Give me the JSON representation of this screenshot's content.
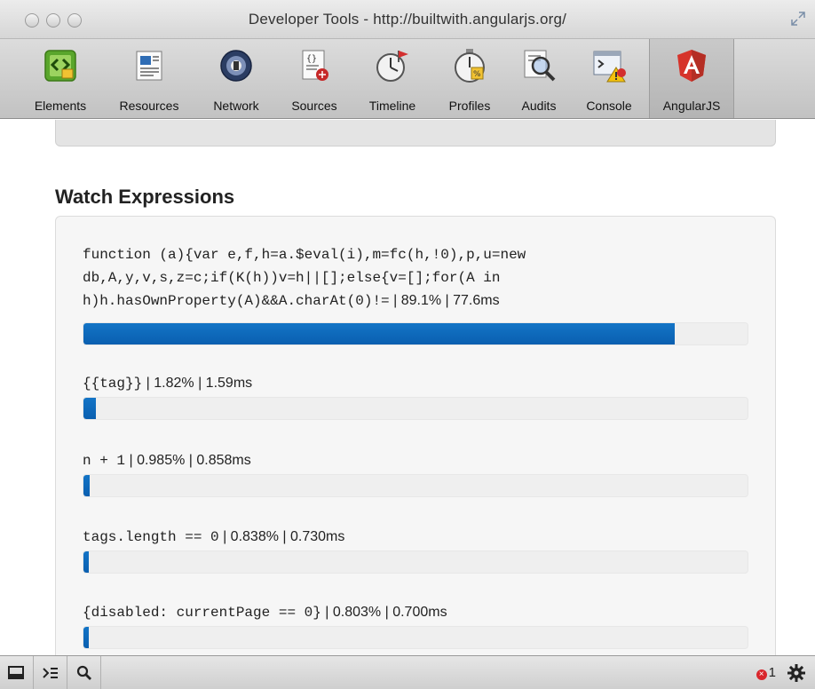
{
  "window": {
    "title": "Developer Tools - http://builtwith.angularjs.org/"
  },
  "toolbar": {
    "tabs": [
      {
        "label": "Elements",
        "icon": "elements-icon"
      },
      {
        "label": "Resources",
        "icon": "resources-icon"
      },
      {
        "label": "Network",
        "icon": "network-icon"
      },
      {
        "label": "Sources",
        "icon": "sources-icon"
      },
      {
        "label": "Timeline",
        "icon": "timeline-icon"
      },
      {
        "label": "Profiles",
        "icon": "profiles-icon"
      },
      {
        "label": "Audits",
        "icon": "audits-icon"
      },
      {
        "label": "Console",
        "icon": "console-icon"
      },
      {
        "label": "AngularJS",
        "icon": "angularjs-icon",
        "active": true
      }
    ]
  },
  "watch": {
    "title": "Watch Expressions",
    "items": [
      {
        "expression": "function (a){var e,f,h=a.$eval(i),m=fc(h,!0),p,u=new db,A,y,v,s,z=c;if(K(h))v=h||[];else{v=[];for(A in h)h.hasOwnProperty(A)&&A.charAt(0)!=",
        "stats": " | 89.1% | 77.6ms",
        "percent": 89.1
      },
      {
        "expression": "{{tag}}",
        "stats": " | 1.82% | 1.59ms",
        "percent": 1.82
      },
      {
        "expression": "n + 1",
        "stats": " | 0.985% | 0.858ms",
        "percent": 0.985
      },
      {
        "expression": "tags.length == 0",
        "stats": " | 0.838% | 0.730ms",
        "percent": 0.838
      },
      {
        "expression": "{disabled: currentPage == 0}",
        "stats": " | 0.803% | 0.700ms",
        "percent": 0.803
      }
    ]
  },
  "statusbar": {
    "error_count": "1"
  },
  "colors": {
    "bar_fill": "#0d67b8",
    "angular_red": "#d6342b",
    "error_red": "#d9262c"
  }
}
